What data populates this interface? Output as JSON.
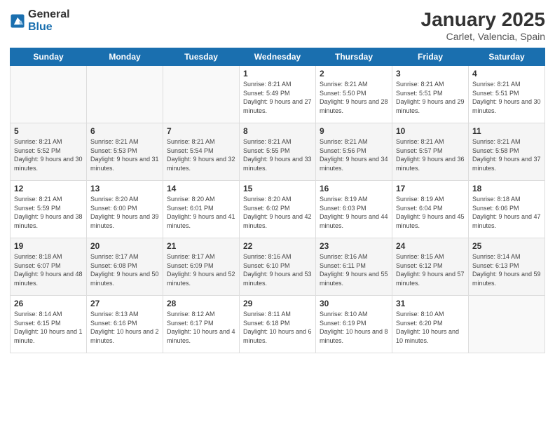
{
  "logo": {
    "general": "General",
    "blue": "Blue"
  },
  "title": "January 2025",
  "subtitle": "Carlet, Valencia, Spain",
  "days_header": [
    "Sunday",
    "Monday",
    "Tuesday",
    "Wednesday",
    "Thursday",
    "Friday",
    "Saturday"
  ],
  "weeks": [
    [
      {
        "day": "",
        "info": ""
      },
      {
        "day": "",
        "info": ""
      },
      {
        "day": "",
        "info": ""
      },
      {
        "day": "1",
        "info": "Sunrise: 8:21 AM\nSunset: 5:49 PM\nDaylight: 9 hours and 27 minutes."
      },
      {
        "day": "2",
        "info": "Sunrise: 8:21 AM\nSunset: 5:50 PM\nDaylight: 9 hours and 28 minutes."
      },
      {
        "day": "3",
        "info": "Sunrise: 8:21 AM\nSunset: 5:51 PM\nDaylight: 9 hours and 29 minutes."
      },
      {
        "day": "4",
        "info": "Sunrise: 8:21 AM\nSunset: 5:51 PM\nDaylight: 9 hours and 30 minutes."
      }
    ],
    [
      {
        "day": "5",
        "info": "Sunrise: 8:21 AM\nSunset: 5:52 PM\nDaylight: 9 hours and 30 minutes."
      },
      {
        "day": "6",
        "info": "Sunrise: 8:21 AM\nSunset: 5:53 PM\nDaylight: 9 hours and 31 minutes."
      },
      {
        "day": "7",
        "info": "Sunrise: 8:21 AM\nSunset: 5:54 PM\nDaylight: 9 hours and 32 minutes."
      },
      {
        "day": "8",
        "info": "Sunrise: 8:21 AM\nSunset: 5:55 PM\nDaylight: 9 hours and 33 minutes."
      },
      {
        "day": "9",
        "info": "Sunrise: 8:21 AM\nSunset: 5:56 PM\nDaylight: 9 hours and 34 minutes."
      },
      {
        "day": "10",
        "info": "Sunrise: 8:21 AM\nSunset: 5:57 PM\nDaylight: 9 hours and 36 minutes."
      },
      {
        "day": "11",
        "info": "Sunrise: 8:21 AM\nSunset: 5:58 PM\nDaylight: 9 hours and 37 minutes."
      }
    ],
    [
      {
        "day": "12",
        "info": "Sunrise: 8:21 AM\nSunset: 5:59 PM\nDaylight: 9 hours and 38 minutes."
      },
      {
        "day": "13",
        "info": "Sunrise: 8:20 AM\nSunset: 6:00 PM\nDaylight: 9 hours and 39 minutes."
      },
      {
        "day": "14",
        "info": "Sunrise: 8:20 AM\nSunset: 6:01 PM\nDaylight: 9 hours and 41 minutes."
      },
      {
        "day": "15",
        "info": "Sunrise: 8:20 AM\nSunset: 6:02 PM\nDaylight: 9 hours and 42 minutes."
      },
      {
        "day": "16",
        "info": "Sunrise: 8:19 AM\nSunset: 6:03 PM\nDaylight: 9 hours and 44 minutes."
      },
      {
        "day": "17",
        "info": "Sunrise: 8:19 AM\nSunset: 6:04 PM\nDaylight: 9 hours and 45 minutes."
      },
      {
        "day": "18",
        "info": "Sunrise: 8:18 AM\nSunset: 6:06 PM\nDaylight: 9 hours and 47 minutes."
      }
    ],
    [
      {
        "day": "19",
        "info": "Sunrise: 8:18 AM\nSunset: 6:07 PM\nDaylight: 9 hours and 48 minutes."
      },
      {
        "day": "20",
        "info": "Sunrise: 8:17 AM\nSunset: 6:08 PM\nDaylight: 9 hours and 50 minutes."
      },
      {
        "day": "21",
        "info": "Sunrise: 8:17 AM\nSunset: 6:09 PM\nDaylight: 9 hours and 52 minutes."
      },
      {
        "day": "22",
        "info": "Sunrise: 8:16 AM\nSunset: 6:10 PM\nDaylight: 9 hours and 53 minutes."
      },
      {
        "day": "23",
        "info": "Sunrise: 8:16 AM\nSunset: 6:11 PM\nDaylight: 9 hours and 55 minutes."
      },
      {
        "day": "24",
        "info": "Sunrise: 8:15 AM\nSunset: 6:12 PM\nDaylight: 9 hours and 57 minutes."
      },
      {
        "day": "25",
        "info": "Sunrise: 8:14 AM\nSunset: 6:13 PM\nDaylight: 9 hours and 59 minutes."
      }
    ],
    [
      {
        "day": "26",
        "info": "Sunrise: 8:14 AM\nSunset: 6:15 PM\nDaylight: 10 hours and 1 minute."
      },
      {
        "day": "27",
        "info": "Sunrise: 8:13 AM\nSunset: 6:16 PM\nDaylight: 10 hours and 2 minutes."
      },
      {
        "day": "28",
        "info": "Sunrise: 8:12 AM\nSunset: 6:17 PM\nDaylight: 10 hours and 4 minutes."
      },
      {
        "day": "29",
        "info": "Sunrise: 8:11 AM\nSunset: 6:18 PM\nDaylight: 10 hours and 6 minutes."
      },
      {
        "day": "30",
        "info": "Sunrise: 8:10 AM\nSunset: 6:19 PM\nDaylight: 10 hours and 8 minutes."
      },
      {
        "day": "31",
        "info": "Sunrise: 8:10 AM\nSunset: 6:20 PM\nDaylight: 10 hours and 10 minutes."
      },
      {
        "day": "",
        "info": ""
      }
    ]
  ]
}
